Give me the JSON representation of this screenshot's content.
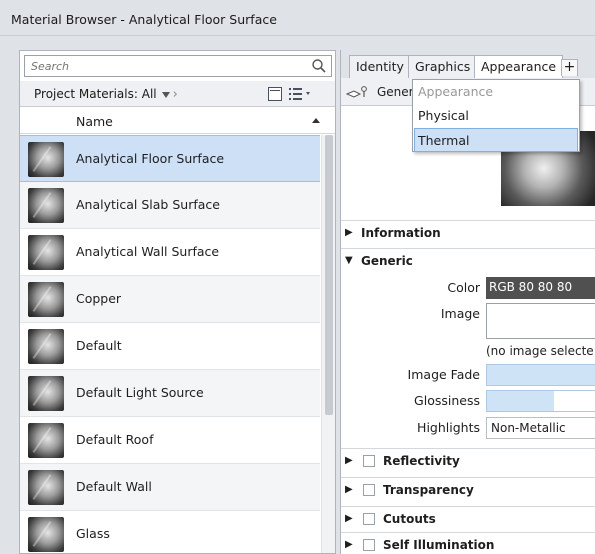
{
  "window": {
    "title": "Material Browser - Analytical Floor Surface"
  },
  "search": {
    "placeholder": "Search"
  },
  "filter": {
    "label": "Project Materials: All"
  },
  "list": {
    "column_header": "Name",
    "items": [
      {
        "name": "Analytical Floor Surface",
        "selected": true
      },
      {
        "name": "Analytical Slab Surface"
      },
      {
        "name": "Analytical Wall Surface"
      },
      {
        "name": "Copper"
      },
      {
        "name": "Default"
      },
      {
        "name": "Default Light Source"
      },
      {
        "name": "Default Roof"
      },
      {
        "name": "Default Wall"
      },
      {
        "name": "Glass"
      }
    ]
  },
  "tabs": [
    {
      "label": "Identity"
    },
    {
      "label": "Graphics"
    },
    {
      "label": "Appearance",
      "active": true
    },
    {
      "label": "+"
    }
  ],
  "asset": {
    "name": "Gener"
  },
  "dropdown": {
    "items": [
      {
        "label": "Appearance",
        "disabled": true
      },
      {
        "label": "Physical"
      },
      {
        "label": "Thermal",
        "hover": true
      }
    ]
  },
  "sections": {
    "information": "Information",
    "generic": "Generic",
    "reflectivity": "Reflectivity",
    "transparency": "Transparency",
    "cutouts": "Cutouts",
    "self_illumination": "Self Illumination"
  },
  "properties": {
    "color_label": "Color",
    "color_value": "RGB 80 80 80",
    "color_hex": "#505050",
    "image_label": "Image",
    "image_value": "(no image selecte",
    "image_fade_label": "Image Fade",
    "image_fade": 1.0,
    "glossiness_label": "Glossiness",
    "glossiness": 0.62,
    "highlights_label": "Highlights",
    "highlights_value": "Non-Metallic"
  }
}
